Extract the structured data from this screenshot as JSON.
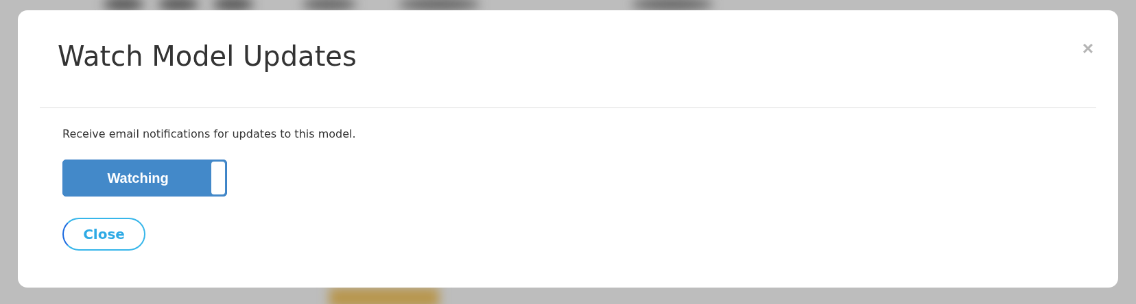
{
  "dialog": {
    "title": "Watch Model Updates",
    "close_icon": "×",
    "description": "Receive email notifications for updates to this model.",
    "toggle": {
      "label": "Watching",
      "on": true
    },
    "buttons": [
      "Close"
    ]
  }
}
